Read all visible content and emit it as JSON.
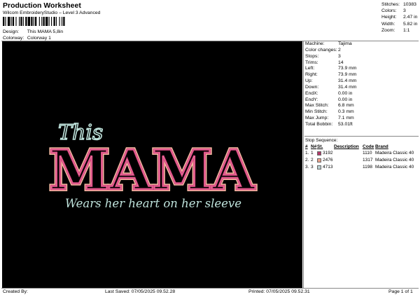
{
  "header": {
    "title": "Production Worksheet",
    "subtitle": "Wilcom EmbroideryStudio – Level 3 Advanced",
    "design_label": "Design:",
    "design_value": "This MAMA 5,8in",
    "colorway_label": "Colorway:",
    "colorway_value": "Colorway 1"
  },
  "summary": [
    {
      "label": "Stitches:",
      "value": "10383"
    },
    {
      "label": "Colors:",
      "value": "3"
    },
    {
      "label": "Height:",
      "value": "2.47 in"
    },
    {
      "label": "Width:",
      "value": "5.82 in"
    },
    {
      "label": "Zoom:",
      "value": "1:1"
    }
  ],
  "machine_info": [
    {
      "label": "Machine:",
      "value": "Tajima"
    },
    {
      "label": "Color changes:",
      "value": "2"
    },
    {
      "label": "Stops:",
      "value": "3"
    },
    {
      "label": "Trims:",
      "value": "14"
    },
    {
      "label": "Left:",
      "value": "73.9 mm"
    },
    {
      "label": "Right:",
      "value": "73.9 mm"
    },
    {
      "label": "Up:",
      "value": "31.4 mm"
    },
    {
      "label": "Down:",
      "value": "31.4 mm"
    },
    {
      "label": "EndX:",
      "value": "0.00 in"
    },
    {
      "label": "EndY:",
      "value": "0.00 in"
    },
    {
      "label": "Max Stitch:",
      "value": "6.8 mm"
    },
    {
      "label": "Min Stitch:",
      "value": "0.3 mm"
    },
    {
      "label": "Max Jump:",
      "value": "7.1 mm"
    },
    {
      "label": "Total Bobbin:",
      "value": "53.01ft"
    }
  ],
  "stop_sequence": {
    "title": "Stop Sequence:",
    "columns": [
      "#",
      "N#",
      "St.",
      "Description",
      "Code",
      "Brand"
    ],
    "rows": [
      {
        "num": "1.",
        "n": "1",
        "color": "#b23a6a",
        "st": "3192",
        "description": "",
        "code": "1110",
        "brand": "Madeira Classic 40"
      },
      {
        "num": "2.",
        "n": "2",
        "color": "#e9a08a",
        "st": "2476",
        "description": "",
        "code": "1317",
        "brand": "Madeira Classic 40"
      },
      {
        "num": "3.",
        "n": "3",
        "color": "#b9cfd0",
        "st": "4713",
        "description": "",
        "code": "1198",
        "brand": "Madeira Classic 40"
      }
    ]
  },
  "design": {
    "line1": "This",
    "line2": "MAMA",
    "line3": "Wears her heart on her sleeve",
    "colors": {
      "pink": "#d3437a",
      "pink_light": "#f07aa5",
      "peach": "#f2b9a0",
      "mint": "#bfe3dc",
      "background": "#000000"
    }
  },
  "footer": {
    "created": "Created By:",
    "saved": "Last Saved: 07/05/2025 09.52.28",
    "printed": "Printed: 07/05/2025 09.52.31",
    "page": "Page 1 of 1"
  }
}
